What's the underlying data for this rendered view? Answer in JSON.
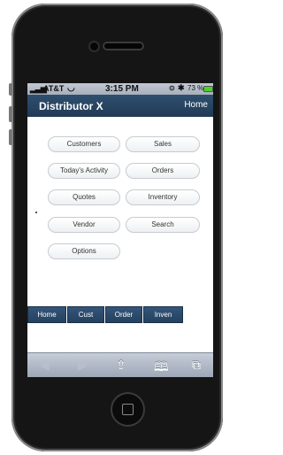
{
  "status_bar": {
    "signal": "▂▃▅",
    "carrier": "AT&T",
    "wifi": "◡",
    "time": "3:15 PM",
    "location": "⊙",
    "bluetooth": "✱",
    "battery": "73 %"
  },
  "app_header": {
    "title": "Distributor X",
    "home_link": "Home"
  },
  "menu_buttons": [
    "Customers",
    "Sales",
    "Today's Activity",
    "Orders",
    "Quotes",
    "Inventory",
    "Vendor",
    "Search",
    "Options"
  ],
  "bottom_tabs": [
    "Home",
    "Cust",
    "Order",
    "Inven"
  ],
  "browser_toolbar": {
    "back_icon": "◀",
    "forward_icon": "▶",
    "share_icon": "⇪",
    "bookmarks_icon": "🕮",
    "tabs_icon": "⧉"
  },
  "colors": {
    "header": "#2a4a6a",
    "tab": "#2e4f72",
    "battery": "#4bd12c"
  }
}
